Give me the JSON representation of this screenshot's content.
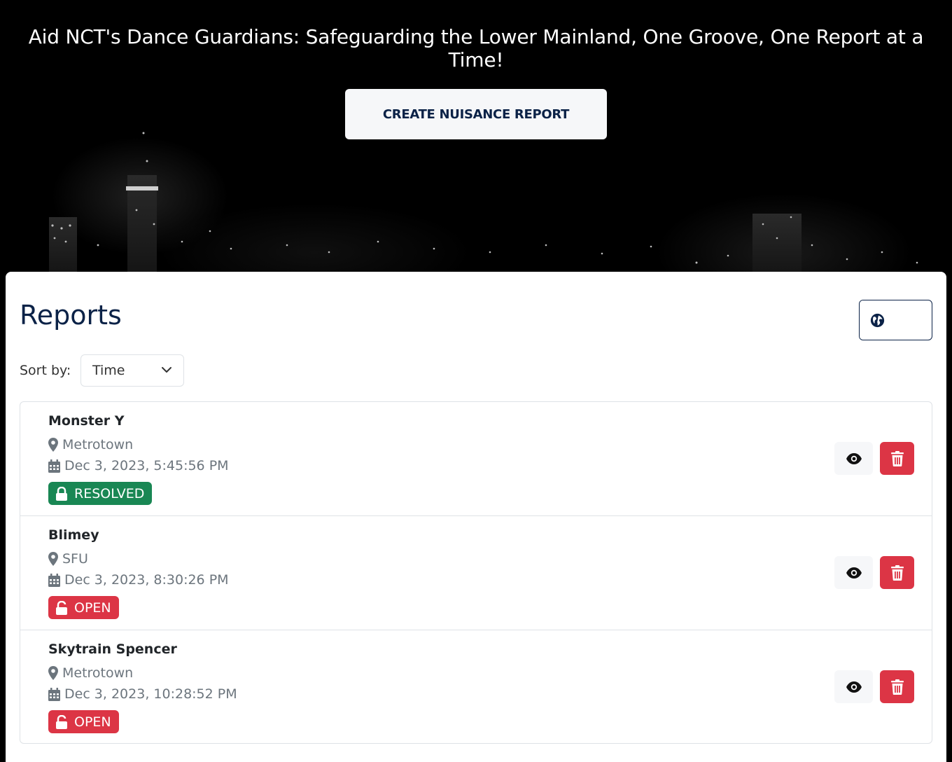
{
  "header": {
    "headline": "Aid NCT's Dance Guardians: Safeguarding the Lower Mainland, One Groove, One Report at a Time!",
    "create_button_label": "CREATE NUISANCE REPORT"
  },
  "reports": {
    "title": "Reports",
    "view_toggle": {
      "map_icon": "globe-icon",
      "list_icon": "list-icon",
      "active": "list"
    },
    "sort": {
      "label": "Sort by:",
      "selected": "Time"
    },
    "items": [
      {
        "name": "Monster Y",
        "location": "Metrotown",
        "datetime": "Dec 3, 2023, 5:45:56 PM",
        "status": "RESOLVED",
        "status_icon": "lock-icon"
      },
      {
        "name": "Blimey",
        "location": "SFU",
        "datetime": "Dec 3, 2023, 8:30:26 PM",
        "status": "OPEN",
        "status_icon": "lock-open-icon"
      },
      {
        "name": "Skytrain Spencer",
        "location": "Metrotown",
        "datetime": "Dec 3, 2023, 10:28:52 PM",
        "status": "OPEN",
        "status_icon": "lock-open-icon"
      }
    ]
  },
  "colors": {
    "navy": "#0b2247",
    "resolved": "#198754",
    "open": "#dc3545",
    "danger_button": "#dc3545"
  }
}
